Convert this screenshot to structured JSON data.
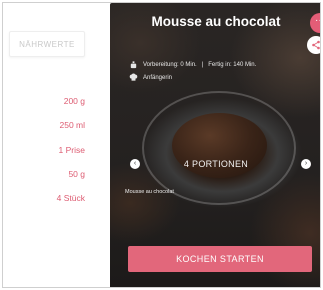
{
  "recipe": {
    "title": "Mousse au chocolat",
    "prep_time": "Vorbereitung: 0 Min.",
    "total_time": "Fertig in: 140 Min.",
    "difficulty": "Anfängerin",
    "portions": "4 PORTIONEN",
    "caption": "Mousse au chocolat"
  },
  "left_panel": {
    "nutrition_tab": "NÄHRWERTE",
    "amounts": [
      "200 g",
      "250 ml",
      "1 Prise",
      "50 g",
      "4 Stück"
    ]
  },
  "actions": {
    "menu_label": "···",
    "cook_label": "KOCHEN STARTEN",
    "prev_label": "‹",
    "next_label": "›"
  },
  "colors": {
    "accent": "#e2677b",
    "amount_text": "#dd5c72"
  },
  "icons": [
    "share-icon",
    "cooking-pot-icon",
    "chef-hat-icon"
  ]
}
